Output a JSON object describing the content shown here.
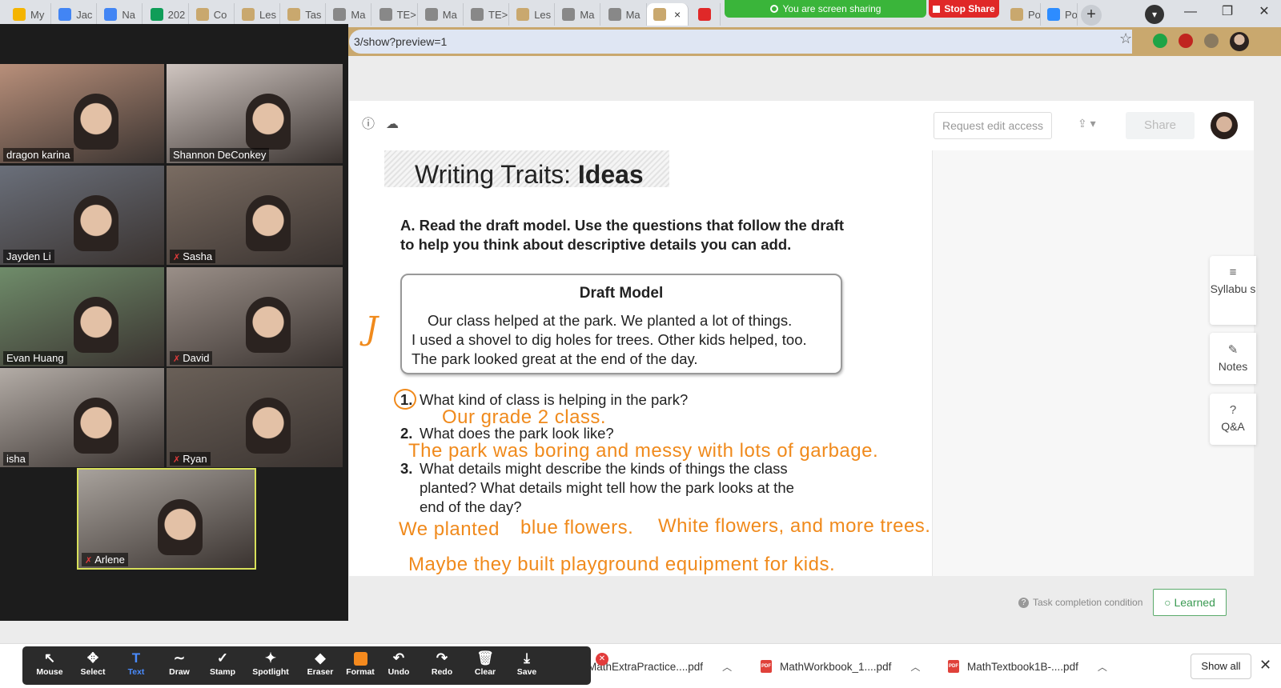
{
  "browser": {
    "tabs": [
      {
        "title": "My",
        "color": "#f4b400"
      },
      {
        "title": "Jac",
        "color": "#4285f4"
      },
      {
        "title": "Na",
        "color": "#4285f4"
      },
      {
        "title": "202",
        "color": "#0f9d58"
      },
      {
        "title": "Co",
        "color": "#c9a86e"
      },
      {
        "title": "Les",
        "color": "#c9a86e"
      },
      {
        "title": "Tas",
        "color": "#c9a86e"
      },
      {
        "title": "Ma",
        "color": "#888888"
      },
      {
        "title": "TE>",
        "color": "#888888"
      },
      {
        "title": "Ma",
        "color": "#888888"
      },
      {
        "title": "TE>",
        "color": "#888888"
      },
      {
        "title": "Les",
        "color": "#c9a86e"
      },
      {
        "title": "Ma",
        "color": "#888888"
      },
      {
        "title": "Ma",
        "color": "#888888"
      }
    ],
    "active_tab_close": "×",
    "sharing_banner": "You are screen sharing",
    "stop_share": "Stop Share",
    "extra_tabs": [
      {
        "title": "Po:",
        "color": "#c9a86e"
      },
      {
        "title": "Po:",
        "color": "#2d8cff"
      }
    ],
    "new_tab": "+",
    "url": "3/show?preview=1",
    "bookmark_star": "☆"
  },
  "doc_toolbar": {
    "info_icon": "ⓘ",
    "cloud_icon": "☁",
    "request_edit": "Request edit access",
    "upload": "⇪ ▾",
    "share": "Share"
  },
  "worksheet": {
    "title_plain": "Writing Traits: ",
    "title_bold": "Ideas",
    "instructions": "A. Read the draft model. Use the questions that follow the draft to help you think about descriptive details you can add.",
    "draft_title": "Draft Model",
    "draft_lines": [
      "Our class helped at the park. We planted a lot of things.",
      "I used a shovel to dig holes for trees. Other kids helped, too.",
      "The park looked great at the end of the day."
    ],
    "questions": [
      {
        "num": "1.",
        "text": "What kind of class is helping in the park?"
      },
      {
        "num": "2.",
        "text": "What does the park look like?"
      },
      {
        "num": "3.",
        "text": "What details might describe the kinds of things the class planted? What details might tell how the park looks at the end of the day?"
      }
    ],
    "handwritten_mark": "J",
    "answers": [
      "Our grade 2 class.",
      "The park was boring and messy with lots of garbage.",
      "We planted",
      "blue flowers.",
      "White flowers, and more trees.",
      "Maybe they built playground equipment for kids."
    ]
  },
  "side_tabs": [
    {
      "icon": "≡",
      "label": "Syllabu s"
    },
    {
      "icon": "✎",
      "label": "Notes"
    },
    {
      "icon": "?",
      "label": "Q&A"
    }
  ],
  "footer": {
    "task_condition": "Task completion condition",
    "learned": "Learned"
  },
  "zoom": {
    "participants": [
      {
        "name": "dragon karina",
        "muted": false,
        "bg": "#b88f7a"
      },
      {
        "name": "Shannon DeConkey",
        "muted": false,
        "bg": "#cfc5c0"
      },
      {
        "name": "Jayden Li",
        "muted": false,
        "bg": "#6a6f7a"
      },
      {
        "name": "Sasha",
        "muted": true,
        "bg": "#7a6c62"
      },
      {
        "name": "Evan Huang",
        "muted": false,
        "bg": "#6f8c6a"
      },
      {
        "name": "David",
        "muted": true,
        "bg": "#9a8f88"
      },
      {
        "name": "isha",
        "muted": false,
        "bg": "#b3aca6"
      },
      {
        "name": "Ryan",
        "muted": true,
        "bg": "#6a6058"
      },
      {
        "name": "Arlene",
        "muted": true,
        "bg": "#a8a29c"
      }
    ],
    "mute_icon": "✗"
  },
  "annotation_tools": [
    {
      "icon": "↖",
      "label": "Mouse"
    },
    {
      "icon": "✥",
      "label": "Select"
    },
    {
      "icon": "T",
      "label": "Text"
    },
    {
      "icon": "∼",
      "label": "Draw"
    },
    {
      "icon": "✓",
      "label": "Stamp"
    },
    {
      "icon": "✦",
      "label": "Spotlight"
    },
    {
      "icon": "◆",
      "label": "Eraser"
    },
    {
      "icon": "",
      "label": "Format"
    },
    {
      "icon": "↶",
      "label": "Undo"
    },
    {
      "icon": "↷",
      "label": "Redo"
    },
    {
      "icon": "🗑",
      "label": "Clear"
    },
    {
      "icon": "⤓",
      "label": "Save"
    }
  ],
  "annot_close": "✕",
  "downloads": {
    "files": [
      {
        "name": "MathExtraPractice....pdf"
      },
      {
        "name": "MathWorkbook_1....pdf"
      },
      {
        "name": "MathTextbook1B-....pdf"
      }
    ],
    "pdf_tag": "PDF",
    "chevron": "︿",
    "show_all": "Show all",
    "close": "✕"
  },
  "colors": {
    "annotation_orange": "#f08a1c",
    "share_green": "#3ab53a",
    "stop_red": "#e02828",
    "learned_green": "#3a9a52"
  }
}
